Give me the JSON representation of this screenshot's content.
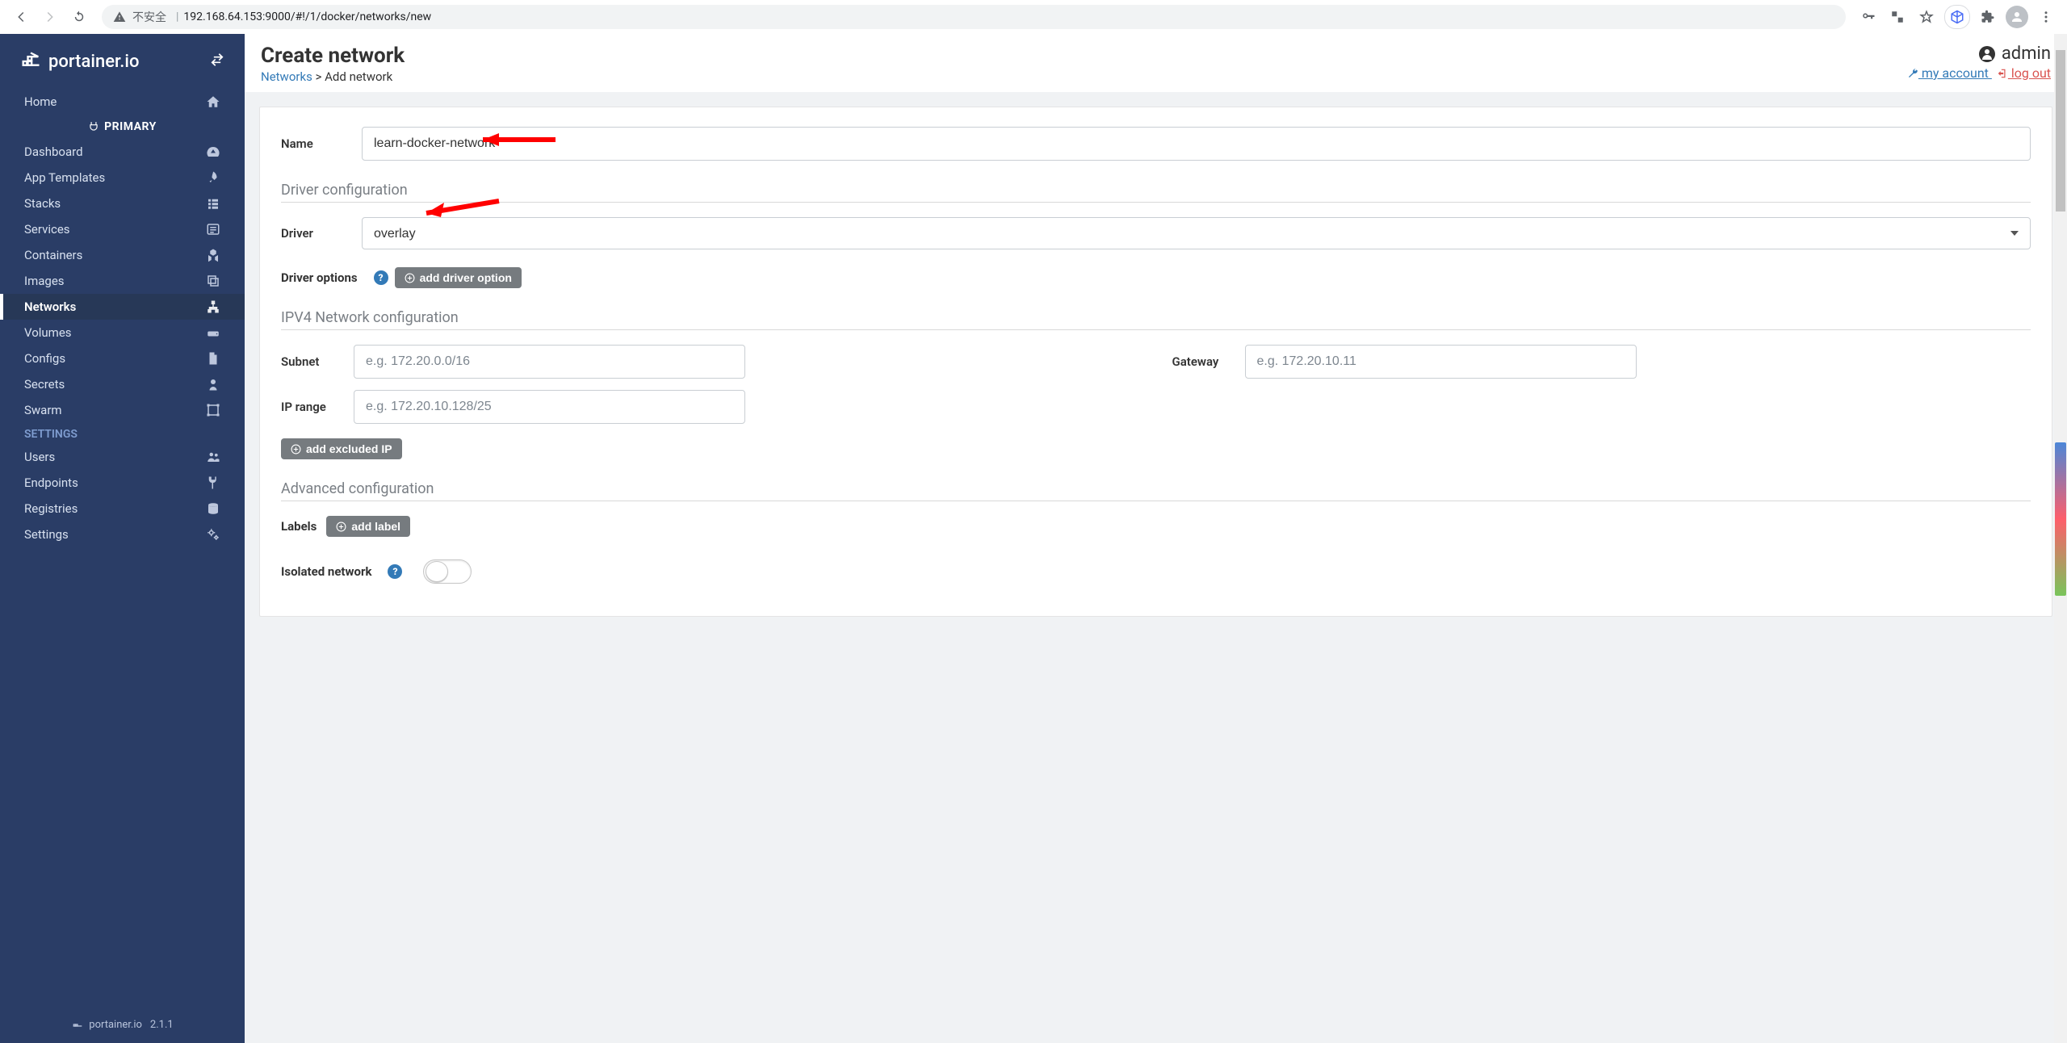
{
  "browser": {
    "insecure_label": "不安全",
    "url": "192.168.64.153:9000/#!/1/docker/networks/new"
  },
  "header": {
    "title": "Create network",
    "breadcrumb_link": "Networks",
    "breadcrumb_current": "Add network",
    "user": "admin",
    "my_account": " my account ",
    "log_out": " log out "
  },
  "sidebar": {
    "brand": "portainer.io",
    "section_primary": "PRIMARY",
    "items": [
      {
        "label": "Home",
        "icon": "home"
      },
      {
        "label": "Dashboard",
        "icon": "dash"
      },
      {
        "label": "App Templates",
        "icon": "rocket"
      },
      {
        "label": "Stacks",
        "icon": "list"
      },
      {
        "label": "Services",
        "icon": "list"
      },
      {
        "label": "Containers",
        "icon": "cubes"
      },
      {
        "label": "Images",
        "icon": "copy"
      },
      {
        "label": "Networks",
        "icon": "sitemap"
      },
      {
        "label": "Volumes",
        "icon": "hdd"
      },
      {
        "label": "Configs",
        "icon": "file"
      },
      {
        "label": "Secrets",
        "icon": "user-secret"
      },
      {
        "label": "Swarm",
        "icon": "objgroup"
      }
    ],
    "settings_header": "SETTINGS",
    "settings_items": [
      {
        "label": "Users",
        "icon": "users"
      },
      {
        "label": "Endpoints",
        "icon": "plug"
      },
      {
        "label": "Registries",
        "icon": "db"
      },
      {
        "label": "Settings",
        "icon": "cogs"
      }
    ],
    "version": "2.1.1"
  },
  "form": {
    "name_label": "Name",
    "name_value": "learn-docker-network",
    "driver_section": "Driver configuration",
    "driver_label": "Driver",
    "driver_value": "overlay",
    "driver_options_label": "Driver options",
    "add_driver_option_btn": "add driver option",
    "ipv4_section": "IPV4 Network configuration",
    "subnet_label": "Subnet",
    "subnet_placeholder": "e.g. 172.20.0.0/16",
    "gateway_label": "Gateway",
    "gateway_placeholder": "e.g. 172.20.10.11",
    "iprange_label": "IP range",
    "iprange_placeholder": "e.g. 172.20.10.128/25",
    "add_excluded_ip_btn": "add excluded IP",
    "advanced_section": "Advanced configuration",
    "labels_label": "Labels",
    "add_label_btn": "add label",
    "isolated_label": "Isolated network"
  }
}
